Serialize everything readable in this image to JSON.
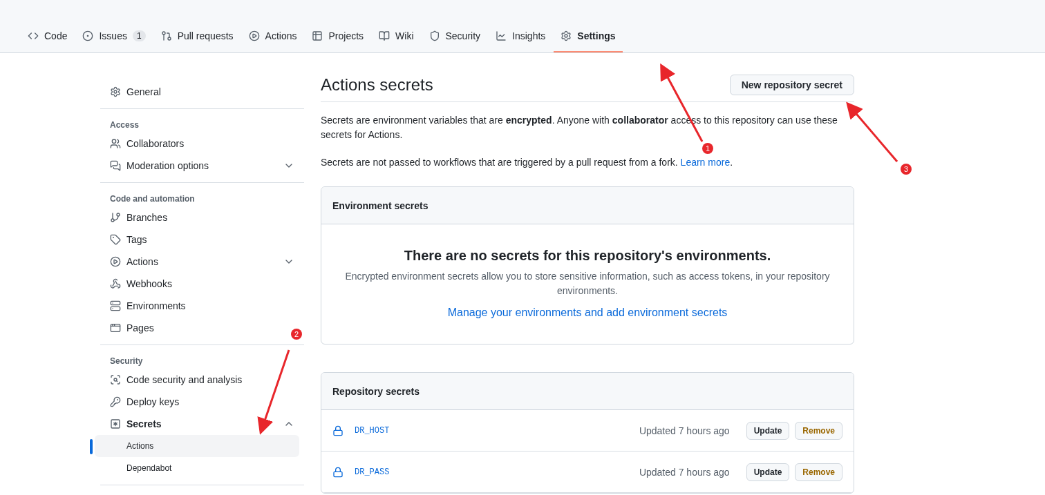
{
  "tabs": [
    {
      "label": "Code",
      "selected": false
    },
    {
      "label": "Issues",
      "counter": "1",
      "selected": false
    },
    {
      "label": "Pull requests",
      "selected": false
    },
    {
      "label": "Actions",
      "selected": false
    },
    {
      "label": "Projects",
      "selected": false
    },
    {
      "label": "Wiki",
      "selected": false
    },
    {
      "label": "Security",
      "selected": false
    },
    {
      "label": "Insights",
      "selected": false
    },
    {
      "label": "Settings",
      "selected": true
    }
  ],
  "sidebar": {
    "sections": [
      {
        "items": [
          {
            "label": "General",
            "selected": false
          }
        ]
      },
      {
        "heading": "Access",
        "items": [
          {
            "label": "Collaborators",
            "selected": false
          },
          {
            "label": "Moderation options",
            "selected": false,
            "expanded": false
          }
        ]
      },
      {
        "heading": "Code and automation",
        "items": [
          {
            "label": "Branches",
            "selected": false
          },
          {
            "label": "Tags",
            "selected": false
          },
          {
            "label": "Actions",
            "selected": false,
            "expanded": false
          },
          {
            "label": "Webhooks",
            "selected": false
          },
          {
            "label": "Environments",
            "selected": false
          },
          {
            "label": "Pages",
            "selected": false
          }
        ]
      },
      {
        "heading": "Security",
        "items": [
          {
            "label": "Code security and analysis",
            "selected": false
          },
          {
            "label": "Deploy keys",
            "selected": false
          },
          {
            "label": "Secrets",
            "selected": false,
            "expanded": true,
            "children": [
              {
                "label": "Actions",
                "selected": true
              },
              {
                "label": "Dependabot",
                "selected": false
              }
            ]
          }
        ]
      }
    ]
  },
  "main": {
    "title": "Actions secrets",
    "new_button": "New repository secret",
    "intro": "Secrets are environment variables that are **encrypted**. Anyone with **collaborator** access to this repository can use these secrets for Actions.",
    "note": {
      "text": "Secrets are not passed to workflows that are triggered by a pull request from a fork.",
      "link": "Learn more",
      "after": "."
    },
    "environment_secrets": {
      "header": "Environment secrets",
      "empty_title": "There are no secrets for this repository's environments.",
      "empty_text": "Encrypted environment secrets allow you to store sensitive information, such as access tokens, in your repository environments.",
      "link": "Manage your environments and add environment secrets"
    },
    "repository_secrets": {
      "header": "Repository secrets",
      "rows": [
        {
          "name": "DR_HOST",
          "updated": "Updated 7 hours ago",
          "update": "Update",
          "remove": "Remove"
        },
        {
          "name": "DR_PASS",
          "updated": "Updated 7 hours ago",
          "update": "Update",
          "remove": "Remove"
        }
      ]
    }
  },
  "annotations": [
    {
      "label": "1"
    },
    {
      "label": "2"
    },
    {
      "label": "3"
    }
  ]
}
